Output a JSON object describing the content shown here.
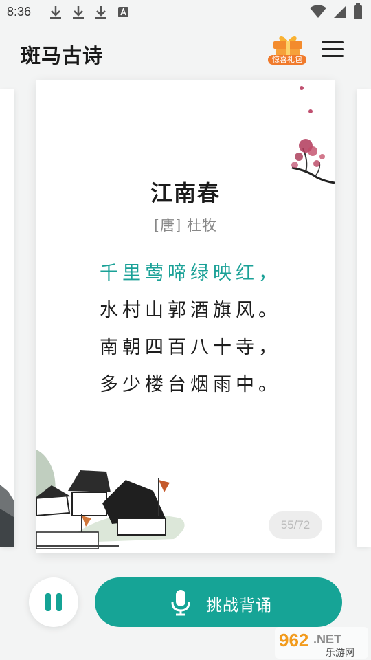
{
  "status_bar": {
    "time": "8:36",
    "notification_icons": [
      "download-icon",
      "download-icon",
      "download-icon",
      "a-box-icon"
    ],
    "system_icons": [
      "wifi-icon",
      "signal-icon",
      "battery-icon"
    ]
  },
  "header": {
    "title": "斑马古诗",
    "gift_label": "惊喜礼包",
    "menu_icon": "hamburger-menu-icon"
  },
  "poem": {
    "title": "江南春",
    "author": "[唐] 杜牧",
    "lines": [
      "千里莺啼绿映红，",
      "水村山郭酒旗风。",
      "南朝四百八十寺，",
      "多少楼台烟雨中。"
    ],
    "active_line_index": 0
  },
  "pagination": "55/72",
  "actions": {
    "pause_icon": "pause-icon",
    "recite_label": "挑战背诵",
    "recite_icon": "microphone-icon"
  },
  "watermark": {
    "number": "962",
    "suffix": ".NET",
    "caption": "乐游网"
  },
  "colors": {
    "accent": "#16a496",
    "active_line": "#1aa197",
    "background": "#f3f4f4"
  }
}
